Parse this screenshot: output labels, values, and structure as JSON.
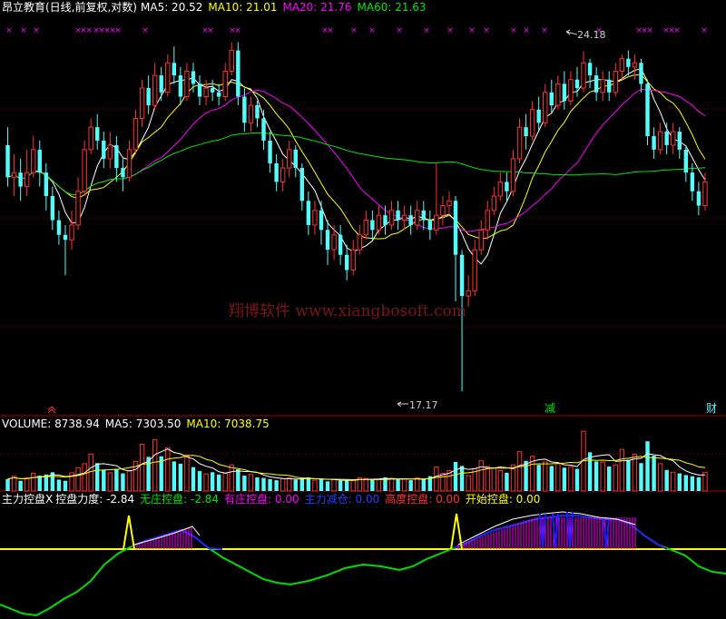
{
  "main_header": {
    "stock": "昂立教育(日线,前复权,对数)",
    "ma5": "MA5: 20.52",
    "ma10": "MA10: 21.01",
    "ma20": "MA20: 21.76",
    "ma60": "MA60: 21.63"
  },
  "volume_header": {
    "volume": "VOLUME: 8738.94",
    "ma5": "MA5: 7303.50",
    "ma10": "MA10: 7038.75"
  },
  "indicator_header": {
    "name": "主力控盘X",
    "strength": "控盘力度: -2.84",
    "no_control": "无庄控盘: -2.84",
    "has_control": "有庄控盘: 0.00",
    "reduce": "主力减仓: 0.00",
    "high": "高度控盘: 0.00",
    "start": "开始控盘: 0.00"
  },
  "annotations": {
    "high_price": "24.18",
    "low_price": "17.17",
    "tag_reduce": "减",
    "tag_finance": "财",
    "watermark": "翔博软件 www.xiangbosoft.com"
  },
  "colors": {
    "up": "#ff3232",
    "down": "#54fcfc",
    "ma5": "#ffffff",
    "ma10": "#ffff00",
    "ma20": "#ff00ff",
    "ma60": "#00e600",
    "grid": "#8b0000",
    "vol_ma5": "#ffffff",
    "vol_ma10": "#ffff00",
    "baseline": "#ffff00",
    "green_line": "#00dd00",
    "blue_line": "#2020ff",
    "magenta": "#ff00ff"
  },
  "chart_data": [
    {
      "type": "candlestick",
      "scale": "log",
      "ylim": [
        16.8,
        25.0
      ],
      "high_mark": 24.18,
      "low_mark": 17.17,
      "candles": [
        [
          22.0,
          21.3,
          22.4,
          21.1
        ],
        [
          21.3,
          21.4,
          21.8,
          20.9
        ],
        [
          21.4,
          21.1,
          21.7,
          20.8
        ],
        [
          21.1,
          21.4,
          21.9,
          20.9
        ],
        [
          21.4,
          21.9,
          22.2,
          21.3
        ],
        [
          21.9,
          21.4,
          22.1,
          21.1
        ],
        [
          21.4,
          20.9,
          21.6,
          20.6
        ],
        [
          20.9,
          20.4,
          21.1,
          20.2
        ],
        [
          20.4,
          20.1,
          20.6,
          19.9
        ],
        [
          20.1,
          20.0,
          20.3,
          19.3
        ],
        [
          20.0,
          20.3,
          20.6,
          19.8
        ],
        [
          20.3,
          21.0,
          21.3,
          20.2
        ],
        [
          21.0,
          21.9,
          22.1,
          20.9
        ],
        [
          21.9,
          22.4,
          22.6,
          21.8
        ],
        [
          22.4,
          22.1,
          22.7,
          21.9
        ],
        [
          22.1,
          21.7,
          22.3,
          21.5
        ],
        [
          21.7,
          22.0,
          22.3,
          21.5
        ],
        [
          22.0,
          21.5,
          22.2,
          21.2
        ],
        [
          21.5,
          21.3,
          21.7,
          21.0
        ],
        [
          21.3,
          21.9,
          22.1,
          21.2
        ],
        [
          21.9,
          22.6,
          22.8,
          21.8
        ],
        [
          22.6,
          23.3,
          23.5,
          22.4
        ],
        [
          23.3,
          22.9,
          23.6,
          22.7
        ],
        [
          22.9,
          23.6,
          23.9,
          22.8
        ],
        [
          23.6,
          23.2,
          23.8,
          23.0
        ],
        [
          23.2,
          23.9,
          24.1,
          23.1
        ],
        [
          23.9,
          23.6,
          24.3,
          23.4
        ],
        [
          23.6,
          23.1,
          23.8,
          22.9
        ],
        [
          23.1,
          23.7,
          23.9,
          23.0
        ],
        [
          23.7,
          23.4,
          23.9,
          23.2
        ],
        [
          23.4,
          23.1,
          23.6,
          22.9
        ],
        [
          23.1,
          23.3,
          23.5,
          22.9
        ],
        [
          23.3,
          23.2,
          23.5,
          23.0
        ],
        [
          23.2,
          23.1,
          23.4,
          22.9
        ],
        [
          23.1,
          23.7,
          23.9,
          23.0
        ],
        [
          23.7,
          24.2,
          24.4,
          23.6
        ],
        [
          24.2,
          23.1,
          24.4,
          22.9
        ],
        [
          23.1,
          22.5,
          23.3,
          22.3
        ],
        [
          22.5,
          22.9,
          23.1,
          22.3
        ],
        [
          22.9,
          22.6,
          23.0,
          22.4
        ],
        [
          22.6,
          22.1,
          22.8,
          21.9
        ],
        [
          22.1,
          21.6,
          22.3,
          21.4
        ],
        [
          21.6,
          21.2,
          21.8,
          21.0
        ],
        [
          21.2,
          21.5,
          21.7,
          21.0
        ],
        [
          21.5,
          21.9,
          22.1,
          21.3
        ],
        [
          21.9,
          21.5,
          22.0,
          21.3
        ],
        [
          21.5,
          20.8,
          21.6,
          20.6
        ],
        [
          20.8,
          20.3,
          21.0,
          20.1
        ],
        [
          20.3,
          20.6,
          20.8,
          20.1
        ],
        [
          20.6,
          20.2,
          20.8,
          19.9
        ],
        [
          20.2,
          19.8,
          20.4,
          19.5
        ],
        [
          19.8,
          20.1,
          20.3,
          19.6
        ],
        [
          20.1,
          19.7,
          20.3,
          19.5
        ],
        [
          19.7,
          19.4,
          19.9,
          19.2
        ],
        [
          19.4,
          19.8,
          20.0,
          19.3
        ],
        [
          19.8,
          20.1,
          20.3,
          19.7
        ],
        [
          20.1,
          20.4,
          20.6,
          20.0
        ],
        [
          20.4,
          20.2,
          20.6,
          20.0
        ],
        [
          20.2,
          20.5,
          20.7,
          20.1
        ],
        [
          20.5,
          20.3,
          20.7,
          20.1
        ],
        [
          20.3,
          20.6,
          20.8,
          20.2
        ],
        [
          20.6,
          20.4,
          20.8,
          20.2
        ],
        [
          20.4,
          20.5,
          20.7,
          20.2
        ],
        [
          20.5,
          20.3,
          20.7,
          20.1
        ],
        [
          20.3,
          20.6,
          20.8,
          20.2
        ],
        [
          20.6,
          20.4,
          20.8,
          20.2
        ],
        [
          20.4,
          20.2,
          20.6,
          20.0
        ],
        [
          20.2,
          20.5,
          21.6,
          20.1
        ],
        [
          20.5,
          20.7,
          20.9,
          20.3
        ],
        [
          20.7,
          20.8,
          21.0,
          20.5
        ],
        [
          20.8,
          19.7,
          20.9,
          18.8
        ],
        [
          19.7,
          18.9,
          19.8,
          17.17
        ],
        [
          18.9,
          19.0,
          19.3,
          18.7
        ],
        [
          19.0,
          19.8,
          20.0,
          18.9
        ],
        [
          19.8,
          20.2,
          20.4,
          19.7
        ],
        [
          20.2,
          20.6,
          20.8,
          20.0
        ],
        [
          20.6,
          20.9,
          21.1,
          20.5
        ],
        [
          20.9,
          21.2,
          21.4,
          20.8
        ],
        [
          21.2,
          21.0,
          21.4,
          20.8
        ],
        [
          21.0,
          21.7,
          21.9,
          20.9
        ],
        [
          21.7,
          22.4,
          22.6,
          21.6
        ],
        [
          22.4,
          22.2,
          22.7,
          21.9
        ],
        [
          22.2,
          22.8,
          23.0,
          22.1
        ],
        [
          22.8,
          22.5,
          23.1,
          22.3
        ],
        [
          22.5,
          23.2,
          23.4,
          22.4
        ],
        [
          23.2,
          22.9,
          23.5,
          22.7
        ],
        [
          22.9,
          23.4,
          23.6,
          22.8
        ],
        [
          23.4,
          23.0,
          23.7,
          22.8
        ],
        [
          23.0,
          23.5,
          23.7,
          22.9
        ],
        [
          23.5,
          23.3,
          23.8,
          23.1
        ],
        [
          23.3,
          23.9,
          24.18,
          23.2
        ],
        [
          23.9,
          23.6,
          24.0,
          23.3
        ],
        [
          23.6,
          23.2,
          23.8,
          23.0
        ],
        [
          23.2,
          23.5,
          23.7,
          23.0
        ],
        [
          23.5,
          23.2,
          23.7,
          23.0
        ],
        [
          23.2,
          23.7,
          23.9,
          23.1
        ],
        [
          23.7,
          24.0,
          24.1,
          23.5
        ],
        [
          24.0,
          23.8,
          24.2,
          23.6
        ],
        [
          23.8,
          23.9,
          24.1,
          23.5
        ],
        [
          23.9,
          23.4,
          24.0,
          23.2
        ],
        [
          23.4,
          22.2,
          23.5,
          22.0
        ],
        [
          22.2,
          21.9,
          22.4,
          21.7
        ],
        [
          21.9,
          22.3,
          22.5,
          21.8
        ],
        [
          22.3,
          22.0,
          22.5,
          21.8
        ],
        [
          22.0,
          22.3,
          22.5,
          21.8
        ],
        [
          22.3,
          21.9,
          22.4,
          21.7
        ],
        [
          21.9,
          21.4,
          22.0,
          21.2
        ],
        [
          21.4,
          21.0,
          21.6,
          20.8
        ],
        [
          21.0,
          20.7,
          21.2,
          20.5
        ],
        [
          20.7,
          21.2,
          21.4,
          20.6
        ]
      ]
    },
    {
      "type": "bar",
      "title": "VOLUME",
      "values": [
        2100,
        2600,
        1800,
        2300,
        3100,
        2700,
        2900,
        3300,
        2000,
        1800,
        3200,
        4100,
        4800,
        6500,
        4900,
        3700,
        3200,
        3900,
        3100,
        3600,
        5200,
        8200,
        6000,
        9000,
        6100,
        7600,
        5200,
        4800,
        6300,
        4200,
        3500,
        3000,
        3300,
        2900,
        3100,
        4600,
        3800,
        2700,
        2900,
        2400,
        2300,
        2100,
        1900,
        2200,
        2300,
        2000,
        2200,
        2400,
        1900,
        2100,
        1700,
        2000,
        1800,
        1900,
        2000,
        2300,
        2200,
        2000,
        2100,
        2400,
        2200,
        2000,
        2100,
        1900,
        2300,
        2100,
        2600,
        4200,
        3100,
        3600,
        5100,
        4400,
        2700,
        3900,
        5300,
        4300,
        4000,
        3600,
        3200,
        4600,
        6900,
        5300,
        6100,
        4600,
        5100,
        4400,
        4800,
        4100,
        4300,
        3900,
        10500,
        6800,
        5200,
        5100,
        4300,
        4600,
        7300,
        5500,
        6500,
        4900,
        8738,
        6200,
        4800,
        3700,
        3300,
        3100,
        2800,
        2600,
        2400,
        3300
      ],
      "ma5_label": "MA5: 7303.50",
      "ma10_label": "MA10: 7038.75"
    },
    {
      "type": "line",
      "title": "主力控盘X",
      "series_values": [
        -2.84
      ]
    }
  ]
}
